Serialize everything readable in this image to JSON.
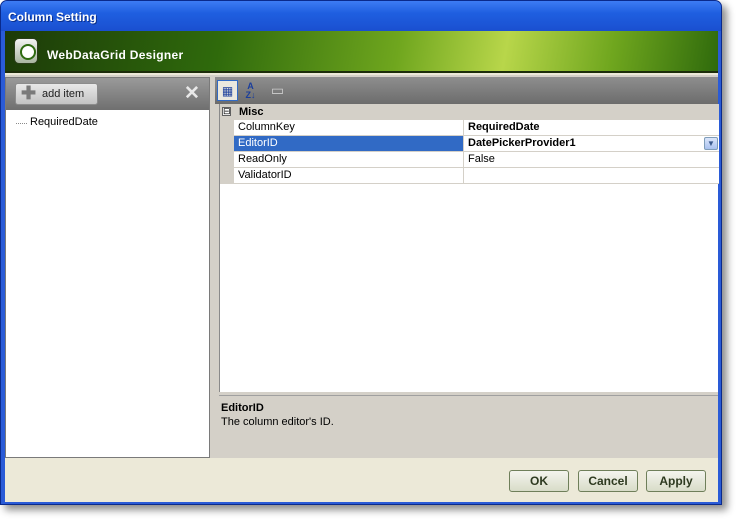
{
  "window": {
    "title": "Column Setting"
  },
  "banner": {
    "title": "WebDataGrid Designer",
    "icon": "grid-designer-icon"
  },
  "left_panel": {
    "add_button_label": "add item",
    "items": [
      "RequiredDate"
    ]
  },
  "property_grid": {
    "category": "Misc",
    "category_toggle": "⊟",
    "rows": [
      {
        "name": "ColumnKey",
        "value": "RequiredDate",
        "bold": true,
        "selected": false
      },
      {
        "name": "EditorID",
        "value": "DatePickerProvider1",
        "bold": true,
        "selected": true,
        "dropdown": true
      },
      {
        "name": "ReadOnly",
        "value": "False",
        "bold": false,
        "selected": false
      },
      {
        "name": "ValidatorID",
        "value": "",
        "bold": false,
        "selected": false
      }
    ]
  },
  "description": {
    "title": "EditorID",
    "text": "The column editor's ID."
  },
  "footer": {
    "ok_label": "OK",
    "cancel_label": "Cancel",
    "apply_label": "Apply"
  },
  "colors": {
    "title_bar": "#1f5fe0",
    "banner": "#6fa61e",
    "selection": "#316ac5"
  }
}
